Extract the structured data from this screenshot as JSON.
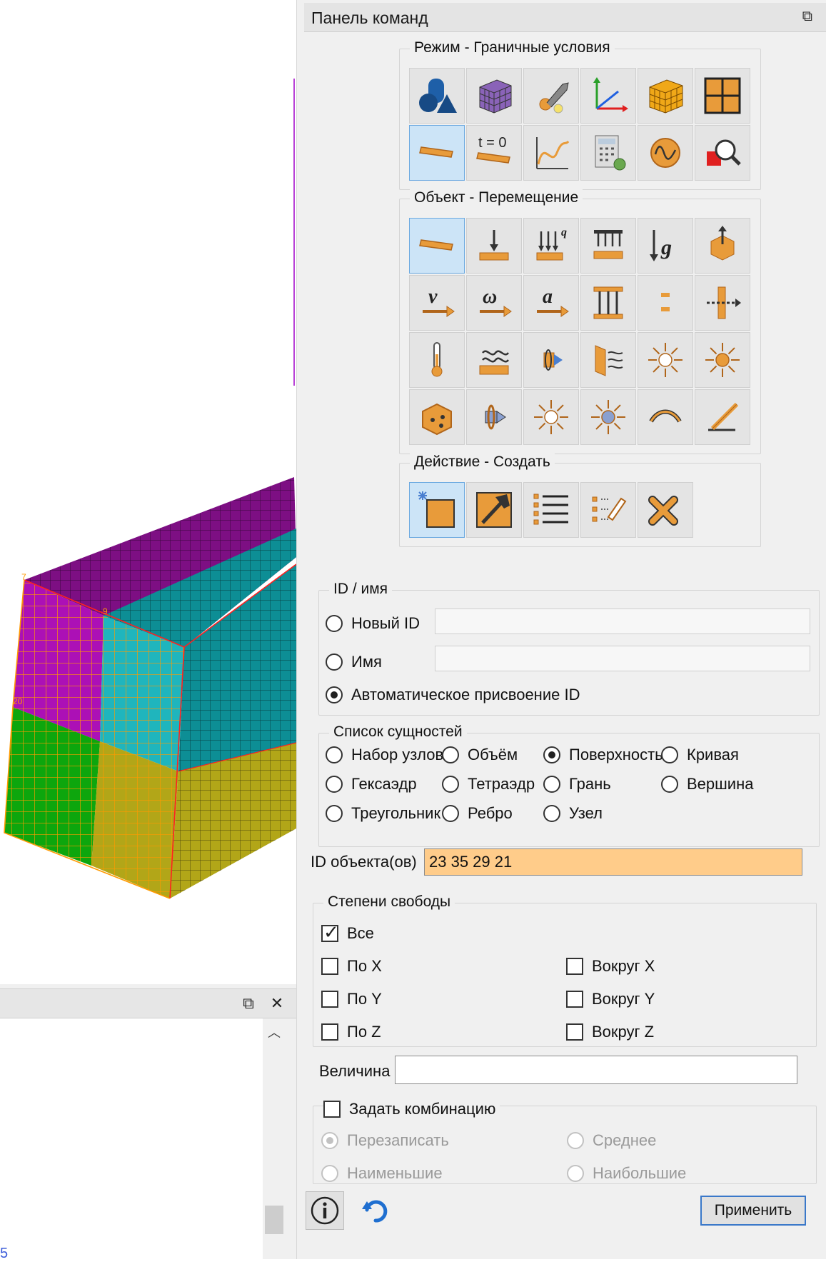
{
  "panel": {
    "title": "Панель команд"
  },
  "mode_group": {
    "title": "Режим - Граничные условия",
    "tools": [
      "geometry-icon",
      "mesh-block-icon",
      "tool-settings-icon",
      "axes-icon",
      "mesh-cube-icon",
      "grid-icon",
      "boundary-condition-icon",
      "initial-condition-icon",
      "function-curve-icon",
      "calculator-icon",
      "wave-icon",
      "inspect-icon"
    ],
    "selected_index": 6,
    "t0_label": "t = 0"
  },
  "object_group": {
    "title": "Объект - Перемещение",
    "tools": [
      "displacement-icon",
      "force-icon",
      "pressure-icon",
      "distributed-load-icon",
      "gravity-icon",
      "rigid-body-icon",
      "velocity-icon",
      "angular-velocity-icon",
      "acceleration-icon",
      "constraint-icon",
      "gap-icon",
      "contact-force-icon",
      "temperature-icon",
      "heat-flux-icon",
      "convection-icon",
      "radiation-icon",
      "point-source-icon",
      "heat-source-icon",
      "volume-load-icon",
      "moment-icon",
      "point-light-icon",
      "sphere-source-icon",
      "spring-icon",
      "bolt-icon"
    ],
    "selected_index": 0,
    "letters": {
      "velocity": "v",
      "omega": "ω",
      "accel": "a",
      "gravity": "g",
      "q": "q"
    }
  },
  "action_group": {
    "title": "Действие - Создать",
    "tools": [
      "create-icon",
      "modify-icon",
      "list-icon",
      "edit-list-icon",
      "delete-icon"
    ],
    "selected_index": 0
  },
  "id_name": {
    "title": "ID / имя",
    "new_id_label": "Новый ID",
    "name_label": "Имя",
    "auto_label": "Автоматическое присвоение ID",
    "selected": "auto"
  },
  "entity_list": {
    "title": "Список сущностей",
    "options": [
      "Набор узлов",
      "Объём",
      "Поверхность",
      "Кривая",
      "Гексаэдр",
      "Тетраэдр",
      "Грань",
      "Вершина",
      "Треугольник",
      "Ребро",
      "Узел"
    ],
    "selected": "Поверхность"
  },
  "object_ids": {
    "label": "ID объекта(ов)",
    "value": "23 35 29 21"
  },
  "dof": {
    "title": "Степени свободы",
    "all_label": "Все",
    "all_checked": true,
    "x_label": "По X",
    "y_label": "По Y",
    "z_label": "По Z",
    "rx_label": "Вокруг X",
    "ry_label": "Вокруг Y",
    "rz_label": "Вокруг Z"
  },
  "magnitude": {
    "label": "Величина",
    "value": ""
  },
  "combination": {
    "label": "Задать комбинацию",
    "checked": false,
    "overwrite_label": "Перезаписать",
    "average_label": "Среднее",
    "min_label": "Наименьшие",
    "max_label": "Наибольшие"
  },
  "footer": {
    "apply_label": "Применить"
  },
  "viewport": {
    "vertex_labels": [
      "7",
      "9",
      "20"
    ],
    "colors": {
      "top": "#7d0f83",
      "teal": "#0d8e95",
      "magenta": "#ac10b6",
      "green": "#0da60d",
      "olive": "#b2a618",
      "cyan": "#1fb5bd"
    }
  },
  "console": {
    "blue_text": "5"
  },
  "colors": {
    "selected_tool": "#cce4f7",
    "object_ids_bg": "#ffcc8a",
    "apply_border": "#3a78c9"
  }
}
